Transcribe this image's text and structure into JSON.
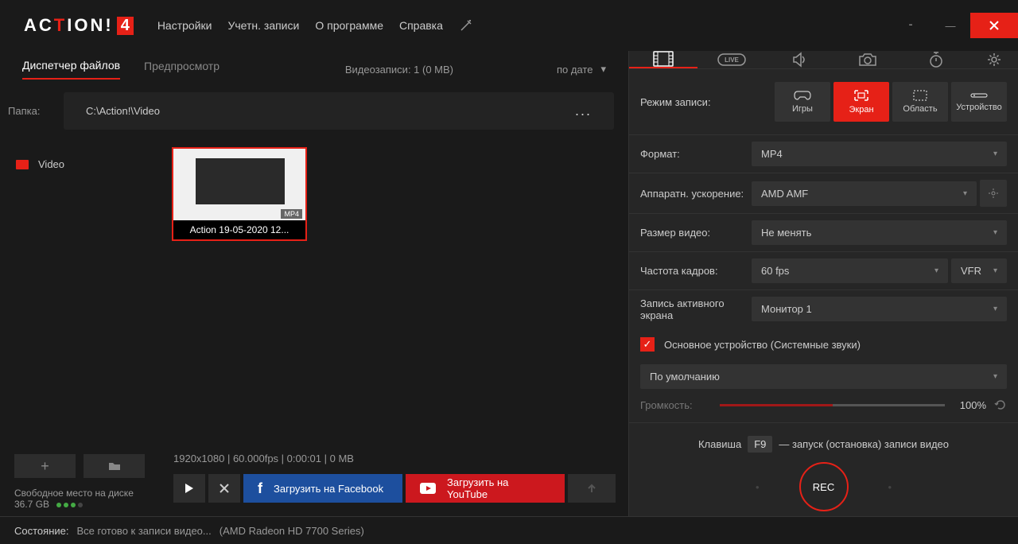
{
  "logo": {
    "part1": "AC",
    "part2": "T",
    "part3": "ION",
    "excl": "!",
    "version": "4"
  },
  "menu": [
    "Настройки",
    "Учетн. записи",
    "О программе",
    "Справка"
  ],
  "tabs": {
    "manager": "Диспетчер файлов",
    "preview": "Предпросмотр"
  },
  "tab_info": "Видеозаписи: 1 (0 MB)",
  "sort_label": "по дате",
  "folder_label": "Папка:",
  "folder_path": "C:\\Action!\\Video",
  "sidebar_folder": "Video",
  "thumb": {
    "caption": "Action 19-05-2020 12...",
    "badge": "MP4"
  },
  "file_info": "1920x1080 | 60.000fps | 0:00:01 | 0 MB",
  "disk": {
    "label": "Свободное место на диске",
    "value": "36.7 GB"
  },
  "upload": {
    "facebook": "Загрузить на Facebook",
    "youtube": "Загрузить на YouTube"
  },
  "right": {
    "rec_mode_label": "Режим записи:",
    "modes": {
      "games": "Игры",
      "screen": "Экран",
      "region": "Область",
      "device": "Устройство"
    },
    "format_label": "Формат:",
    "format_value": "MP4",
    "hw_label": "Аппаратн. ускорение:",
    "hw_value": "AMD AMF",
    "size_label": "Размер видео:",
    "size_value": "Не менять",
    "fps_label": "Частота кадров:",
    "fps_value": "60 fps",
    "vfr": "VFR",
    "active_label": "Запись активного экрана",
    "active_value": "Монитор 1",
    "audio_label": "Основное устройство (Системные звуки)",
    "audio_device": "По умолчанию",
    "volume_label": "Громкость:",
    "volume_value": "100%",
    "hotkey_pre": "Клавиша",
    "hotkey": "F9",
    "hotkey_post": "— запуск (остановка) записи видео",
    "rec": "REC"
  },
  "status": {
    "label": "Состояние:",
    "text": "Все готово к записи видео...",
    "gpu": "(AMD Radeon HD 7700 Series)"
  }
}
